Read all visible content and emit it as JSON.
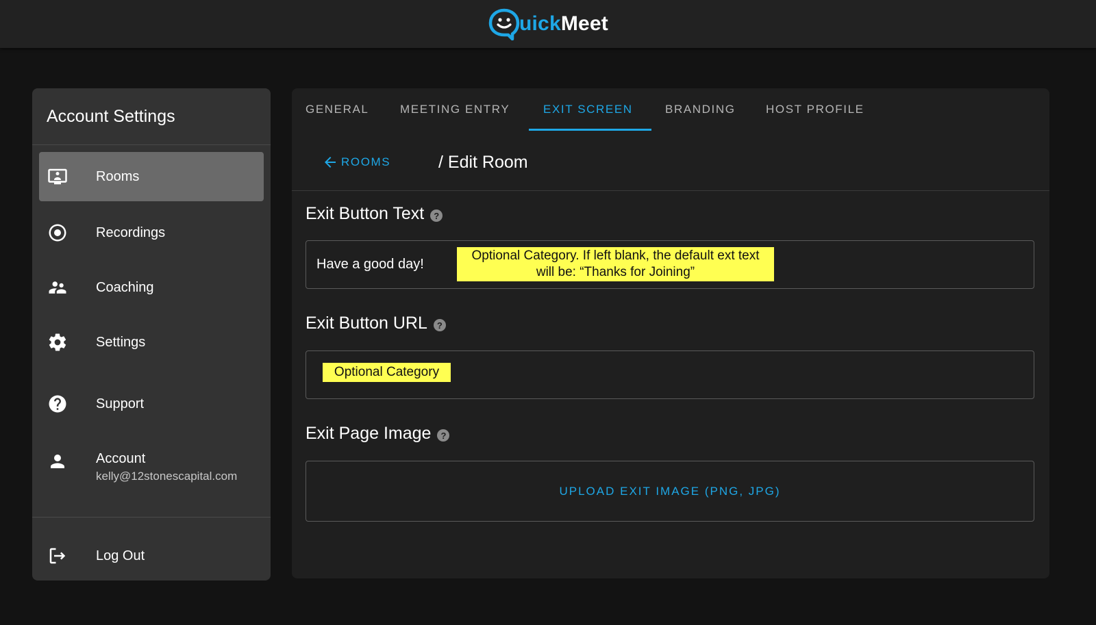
{
  "brand": {
    "logo_part1": "uick",
    "logo_part2": "Meet",
    "accent": "#1ea7e6"
  },
  "sidebar": {
    "title": "Account Settings",
    "items": [
      {
        "label": "Rooms",
        "icon": "monitor-person-icon",
        "active": true
      },
      {
        "label": "Recordings",
        "icon": "record-circle-icon"
      },
      {
        "label": "Coaching",
        "icon": "people-icon"
      },
      {
        "label": "Settings",
        "icon": "gear-icon"
      },
      {
        "label": "Support",
        "icon": "help-circle-icon"
      },
      {
        "label": "Account",
        "sub": "kelly@12stonescapital.com",
        "icon": "person-icon"
      },
      {
        "label": "Log Out",
        "icon": "logout-icon"
      }
    ]
  },
  "tabs": [
    {
      "label": "GENERAL"
    },
    {
      "label": "MEETING ENTRY"
    },
    {
      "label": "EXIT SCREEN",
      "active": true
    },
    {
      "label": "BRANDING"
    },
    {
      "label": "HOST PROFILE"
    }
  ],
  "breadcrumb": {
    "back_label": "ROOMS",
    "current": "/ Edit Room"
  },
  "form": {
    "exit_text": {
      "label": "Exit Button Text",
      "value": "Have a good day!",
      "note_line1": "Optional Category. If left blank, the default ext text",
      "note_line2": "will be: “Thanks for Joining”"
    },
    "exit_url": {
      "label": "Exit Button URL",
      "note": "Optional Category"
    },
    "exit_image": {
      "label": "Exit Page Image",
      "upload_label": "UPLOAD EXIT IMAGE (PNG, JPG)"
    },
    "help_glyph": "?"
  }
}
